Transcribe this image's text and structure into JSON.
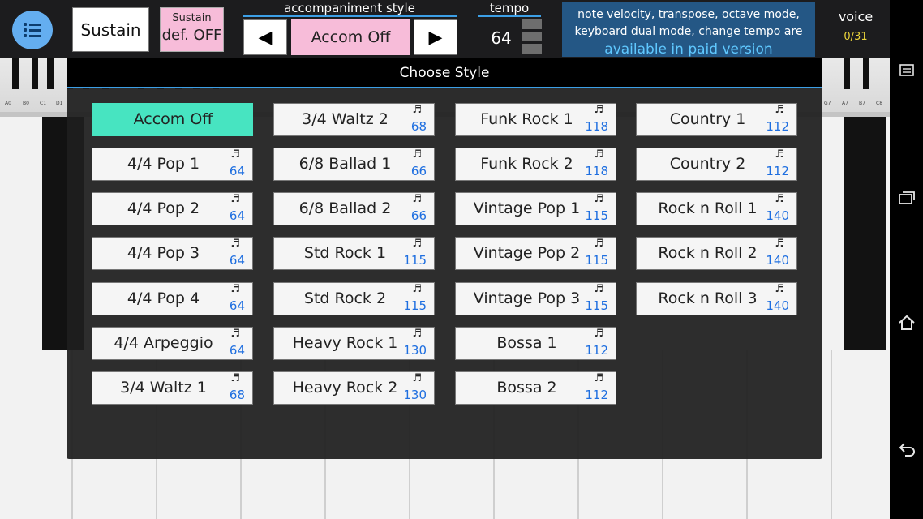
{
  "toolbar": {
    "sustain_label": "Sustain",
    "sustain_default_line1": "Sustain",
    "sustain_default_line2": "def. OFF",
    "accompaniment_label": "accompaniment style",
    "accompaniment_value": "Accom Off",
    "prev_arrow": "◀",
    "next_arrow": "▶",
    "tempo_label": "tempo",
    "tempo_value": "64",
    "paid_text_line1": "note velocity, transpose, octave mode,",
    "paid_text_line2": "keyboard dual mode, change tempo are",
    "paid_text_line3": "available in paid version",
    "voice_label": "voice",
    "voice_count": "0/31"
  },
  "keyboard": {
    "note_labels_left": [
      "A0",
      "B0",
      "C1",
      "D1"
    ],
    "note_labels_right": [
      "G7",
      "A7",
      "B7",
      "C8"
    ]
  },
  "navbar": {
    "recents_icon": "recents-icon",
    "home_icon": "home-icon",
    "back_icon": "back-icon",
    "menu_icon": "menu-icon"
  },
  "dialog": {
    "title": "Choose Style",
    "note_symbol": "♬",
    "columns": [
      [
        {
          "name": "Accom Off",
          "bpm": "",
          "selected": true
        },
        {
          "name": "4/4 Pop 1",
          "bpm": "64"
        },
        {
          "name": "4/4 Pop 2",
          "bpm": "64"
        },
        {
          "name": "4/4 Pop 3",
          "bpm": "64"
        },
        {
          "name": "4/4 Pop 4",
          "bpm": "64"
        },
        {
          "name": "4/4 Arpeggio",
          "bpm": "64"
        },
        {
          "name": "3/4 Waltz 1",
          "bpm": "68"
        }
      ],
      [
        {
          "name": "3/4 Waltz 2",
          "bpm": "68"
        },
        {
          "name": "6/8 Ballad 1",
          "bpm": "66"
        },
        {
          "name": "6/8 Ballad 2",
          "bpm": "66"
        },
        {
          "name": "Std Rock 1",
          "bpm": "115"
        },
        {
          "name": "Std Rock 2",
          "bpm": "115"
        },
        {
          "name": "Heavy Rock 1",
          "bpm": "130"
        },
        {
          "name": "Heavy Rock 2",
          "bpm": "130"
        }
      ],
      [
        {
          "name": "Funk Rock 1",
          "bpm": "118"
        },
        {
          "name": "Funk Rock 2",
          "bpm": "118"
        },
        {
          "name": "Vintage Pop 1",
          "bpm": "115"
        },
        {
          "name": "Vintage Pop 2",
          "bpm": "115"
        },
        {
          "name": "Vintage Pop 3",
          "bpm": "115"
        },
        {
          "name": "Bossa 1",
          "bpm": "112"
        },
        {
          "name": "Bossa 2",
          "bpm": "112"
        }
      ],
      [
        {
          "name": "Country 1",
          "bpm": "112"
        },
        {
          "name": "Country 2",
          "bpm": "112"
        },
        {
          "name": "Rock n Roll 1",
          "bpm": "140"
        },
        {
          "name": "Rock n Roll 2",
          "bpm": "140"
        },
        {
          "name": "Rock n Roll 3",
          "bpm": "140"
        }
      ]
    ]
  },
  "colors": {
    "accent": "#3c9fe6",
    "selected_style": "#47e4c1",
    "pink_button": "#f7bcd9",
    "bpm_text": "#1f6fe0",
    "paid_box": "#245785"
  }
}
